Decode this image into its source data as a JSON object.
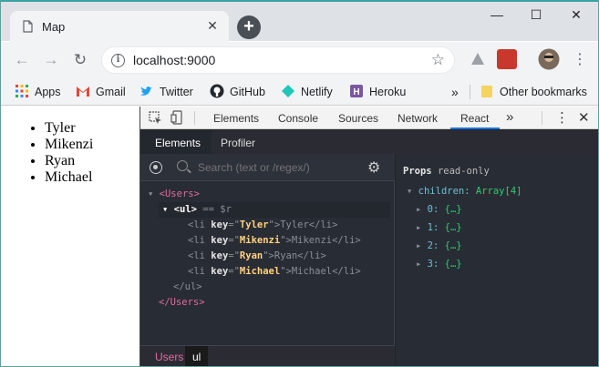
{
  "browser": {
    "tab_title": "Map",
    "url": "localhost:9000",
    "window_controls": [
      "—",
      "☐",
      "✕"
    ]
  },
  "bookmarks": {
    "items": [
      {
        "label": "Apps"
      },
      {
        "label": "Gmail"
      },
      {
        "label": "Twitter"
      },
      {
        "label": "GitHub"
      },
      {
        "label": "Netlify"
      },
      {
        "label": "Heroku"
      }
    ],
    "more": "»",
    "other": "Other bookmarks"
  },
  "page": {
    "list": [
      "Tyler",
      "Mikenzi",
      "Ryan",
      "Michael"
    ]
  },
  "devtools": {
    "tabs": [
      "Elements",
      "Console",
      "Sources",
      "Network",
      "React"
    ],
    "active_tab": "React",
    "more": "»",
    "react_tabs": [
      "Elements",
      "Profiler"
    ],
    "search_placeholder": "Search (text or /regex/)",
    "tree": {
      "users_open": "<Users>",
      "ul_open": "<ul>",
      "ul_eq": "== $r",
      "items": [
        {
          "key": "Tyler",
          "text": "Tyler"
        },
        {
          "key": "Mikenzi",
          "text": "Mikenzi"
        },
        {
          "key": "Ryan",
          "text": "Ryan"
        },
        {
          "key": "Michael",
          "text": "Michael"
        }
      ],
      "ul_close": "</ul>",
      "users_close": "</Users>"
    },
    "breadcrumbs": [
      "Users",
      "ul"
    ],
    "props": {
      "title": "Props",
      "readonly": "read-only",
      "children_key": "children:",
      "children_val": "Array[4]",
      "entries": [
        {
          "k": "0:",
          "v": "{…}"
        },
        {
          "k": "1:",
          "v": "{…}"
        },
        {
          "k": "2:",
          "v": "{…}"
        },
        {
          "k": "3:",
          "v": "{…}"
        }
      ]
    }
  },
  "colors": {
    "accent": "#1a73e8",
    "tag_pink": "#e06c9f",
    "key_yellow": "#ffd27f",
    "prop_blue": "#6dc0d6",
    "value_green": "#2ecc71"
  }
}
